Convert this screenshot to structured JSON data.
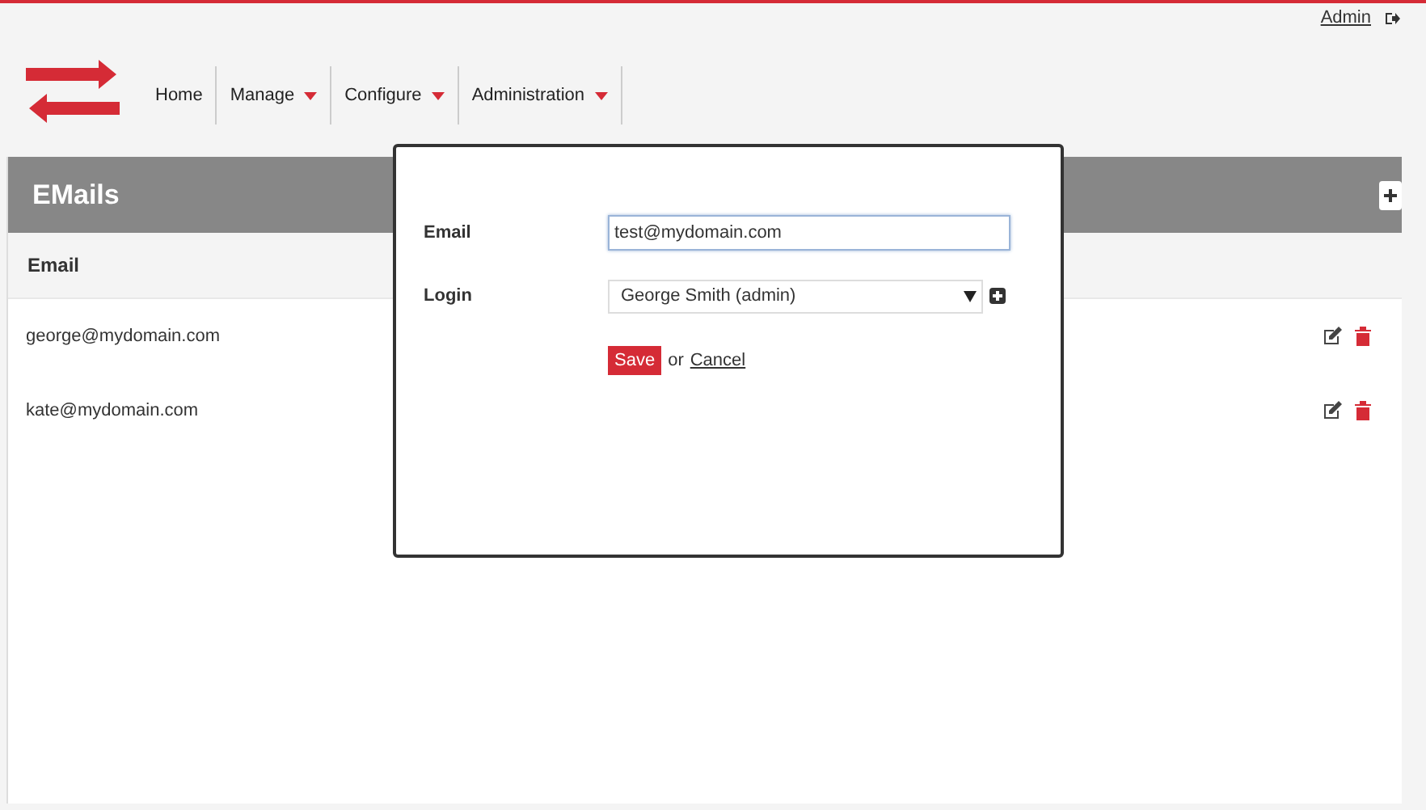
{
  "user": {
    "name": "Admin"
  },
  "nav": [
    {
      "label": "Home",
      "dropdown": false
    },
    {
      "label": "Manage",
      "dropdown": true
    },
    {
      "label": "Configure",
      "dropdown": true
    },
    {
      "label": "Administration",
      "dropdown": true
    }
  ],
  "panel": {
    "title": "EMails",
    "columns": [
      "Email"
    ],
    "rows": [
      {
        "email": "george@mydomain.com"
      },
      {
        "email": "kate@mydomain.com"
      }
    ]
  },
  "dialog": {
    "fields": [
      {
        "kind": "text",
        "label": "Email",
        "value": "test@mydomain.com",
        "focused": true
      },
      {
        "kind": "select",
        "label": "Login",
        "value": "George Smith (admin)"
      }
    ],
    "save": "Save",
    "or": "or",
    "cancel": "Cancel"
  }
}
